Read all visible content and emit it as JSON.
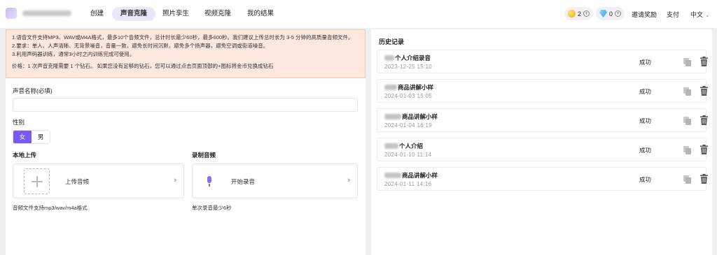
{
  "nav": {
    "tabs": [
      "创建",
      "声音克隆",
      "照片孪生",
      "视频克隆",
      "我的结果"
    ],
    "active_tab": "声音克隆",
    "coins": "2",
    "gems": "0",
    "invite": "邀请奖励",
    "pay": "支付",
    "language": "中文"
  },
  "notice": {
    "line1": "1.语音文件支持MP3、WAV或M4A格式，最多10个音频文件，总计时长最少60秒，最多600秒。我们建议上传总时长为 3-5 分钟的高质量音频文件。",
    "line2": "2.要求：单人、人声清晰、无背景噪音，音量一致，避免长时间沉默，避免多个扬声器，避免空调或街道噪音。",
    "line3": "3.利用声码器训练，通常3小时之内训练完成可使用。",
    "price": "价格：1 次声音克隆需要 1 个钻石。 如果您没有足够的钻石，您可以通过点击页面顶部的+图标将金币兑换成钻石"
  },
  "form": {
    "voice_name_label": "声音名称(必填)",
    "voice_name_value": "",
    "gender_label": "性别",
    "gender_female": "女",
    "gender_male": "男",
    "local_upload_label": "本地上传",
    "upload_button": "上传音频",
    "upload_hint": "音频文件支持mp3/wav/m4a格式",
    "record_label": "录制音频",
    "record_button": "开始录音",
    "record_hint": "单次录音最少6秒"
  },
  "history": {
    "title": "历史记录",
    "items": [
      {
        "name": "个人介绍录音",
        "date": "2023-12-25 15:10",
        "status": "成功"
      },
      {
        "name": "商品讲解小样",
        "date": "2024-01-03 15:05",
        "status": "成功"
      },
      {
        "name": "商品讲解小样",
        "date": "2024-01-04 16:19",
        "status": "成功"
      },
      {
        "name": "个人介绍",
        "date": "2024-01-10 11:14",
        "status": "成功"
      },
      {
        "name": "商品讲解小样",
        "date": "2024-01-11 14:16",
        "status": "成功"
      }
    ]
  },
  "icons": {
    "coin": "coin-icon",
    "gem": "diamond-icon",
    "plus": "plus-circle-icon",
    "upload": "plus-icon",
    "mic": "microphone-icon",
    "copy": "copy-icon",
    "delete": "trash-icon"
  },
  "colors": {
    "accent": "#7a5af0",
    "notice_bg": "#fde8df",
    "active_tab_bg": "#e9e7f8"
  }
}
